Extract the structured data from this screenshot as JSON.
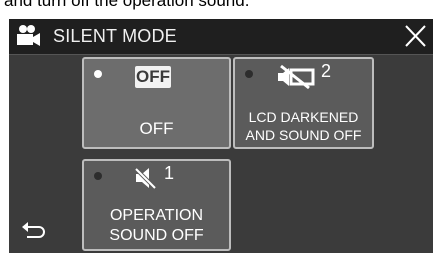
{
  "caption": "and turn off the operation sound.",
  "header": {
    "icon": "movie-camera-icon",
    "title": "SILENT MODE",
    "close_icon": "close-icon"
  },
  "options": [
    {
      "id": "off",
      "badge": "OFF",
      "label": "OFF",
      "selected": true
    },
    {
      "id": "lcd_darkened",
      "icon": "lcd-sound-off-icon",
      "superscript": "2",
      "label_lines": [
        "LCD DARKENED",
        "AND SOUND OFF"
      ],
      "selected": false
    },
    {
      "id": "operation_sound_off",
      "icon": "speaker-muted-icon",
      "superscript": "1",
      "label_lines": [
        "OPERATION",
        "SOUND OFF"
      ],
      "selected": false
    }
  ],
  "footer": {
    "back_icon": "back-arrow-icon"
  }
}
